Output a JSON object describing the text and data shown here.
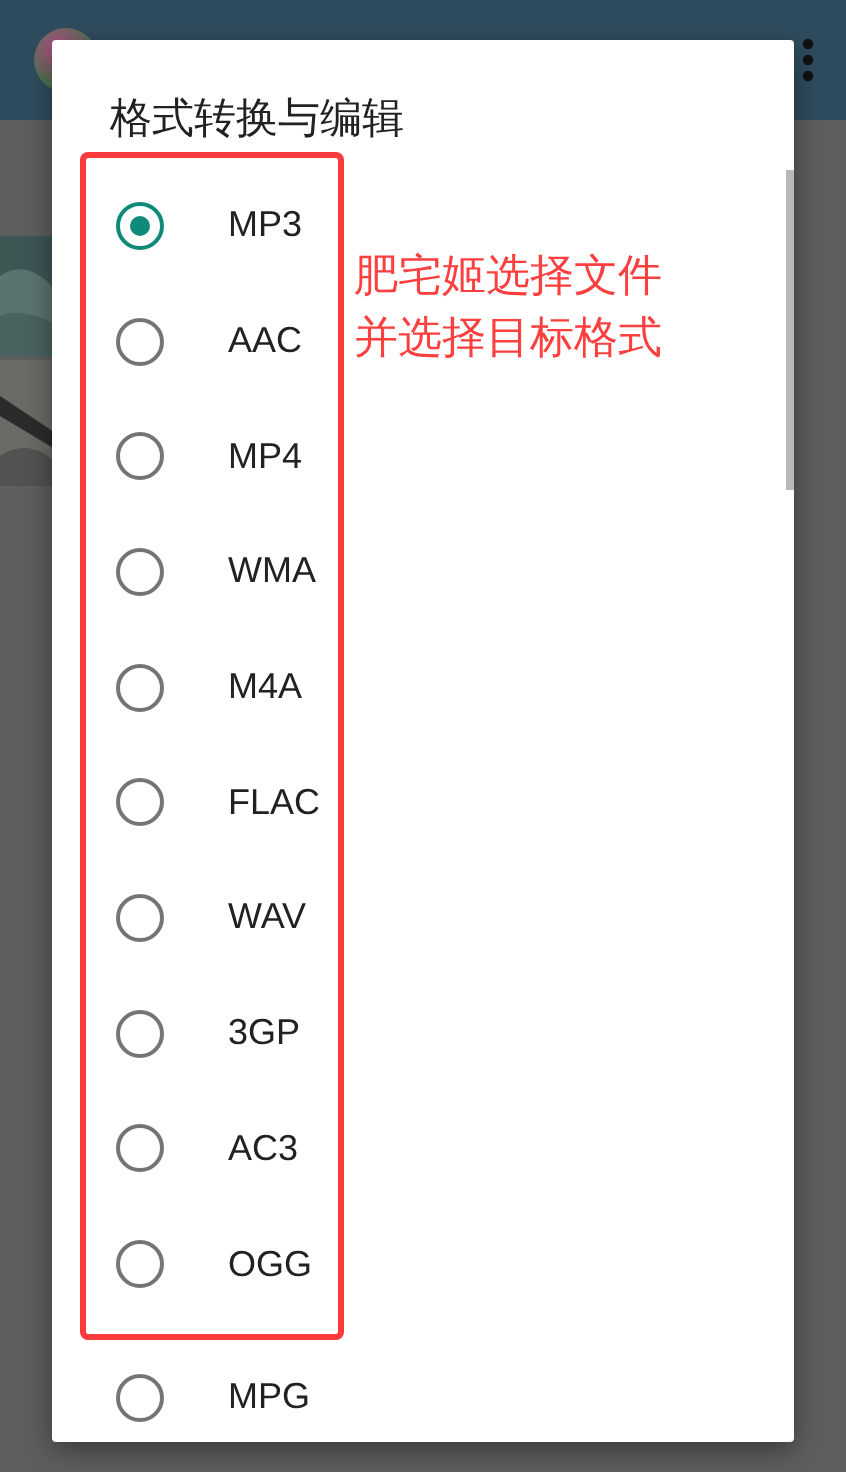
{
  "dialog": {
    "title": "格式转换与编辑",
    "options": [
      {
        "label": "MP3",
        "selected": true,
        "highlighted": true
      },
      {
        "label": "AAC",
        "selected": false,
        "highlighted": true
      },
      {
        "label": "MP4",
        "selected": false,
        "highlighted": true
      },
      {
        "label": "WMA",
        "selected": false,
        "highlighted": true
      },
      {
        "label": "M4A",
        "selected": false,
        "highlighted": true
      },
      {
        "label": "FLAC",
        "selected": false,
        "highlighted": true
      },
      {
        "label": "WAV",
        "selected": false,
        "highlighted": true
      },
      {
        "label": "3GP",
        "selected": false,
        "highlighted": true
      },
      {
        "label": "AC3",
        "selected": false,
        "highlighted": true
      },
      {
        "label": "OGG",
        "selected": false,
        "highlighted": true
      },
      {
        "label": "MPG",
        "selected": false,
        "highlighted": false
      }
    ]
  },
  "annotation": [
    "肥宅姬选择文件",
    "并选择目标格式"
  ]
}
